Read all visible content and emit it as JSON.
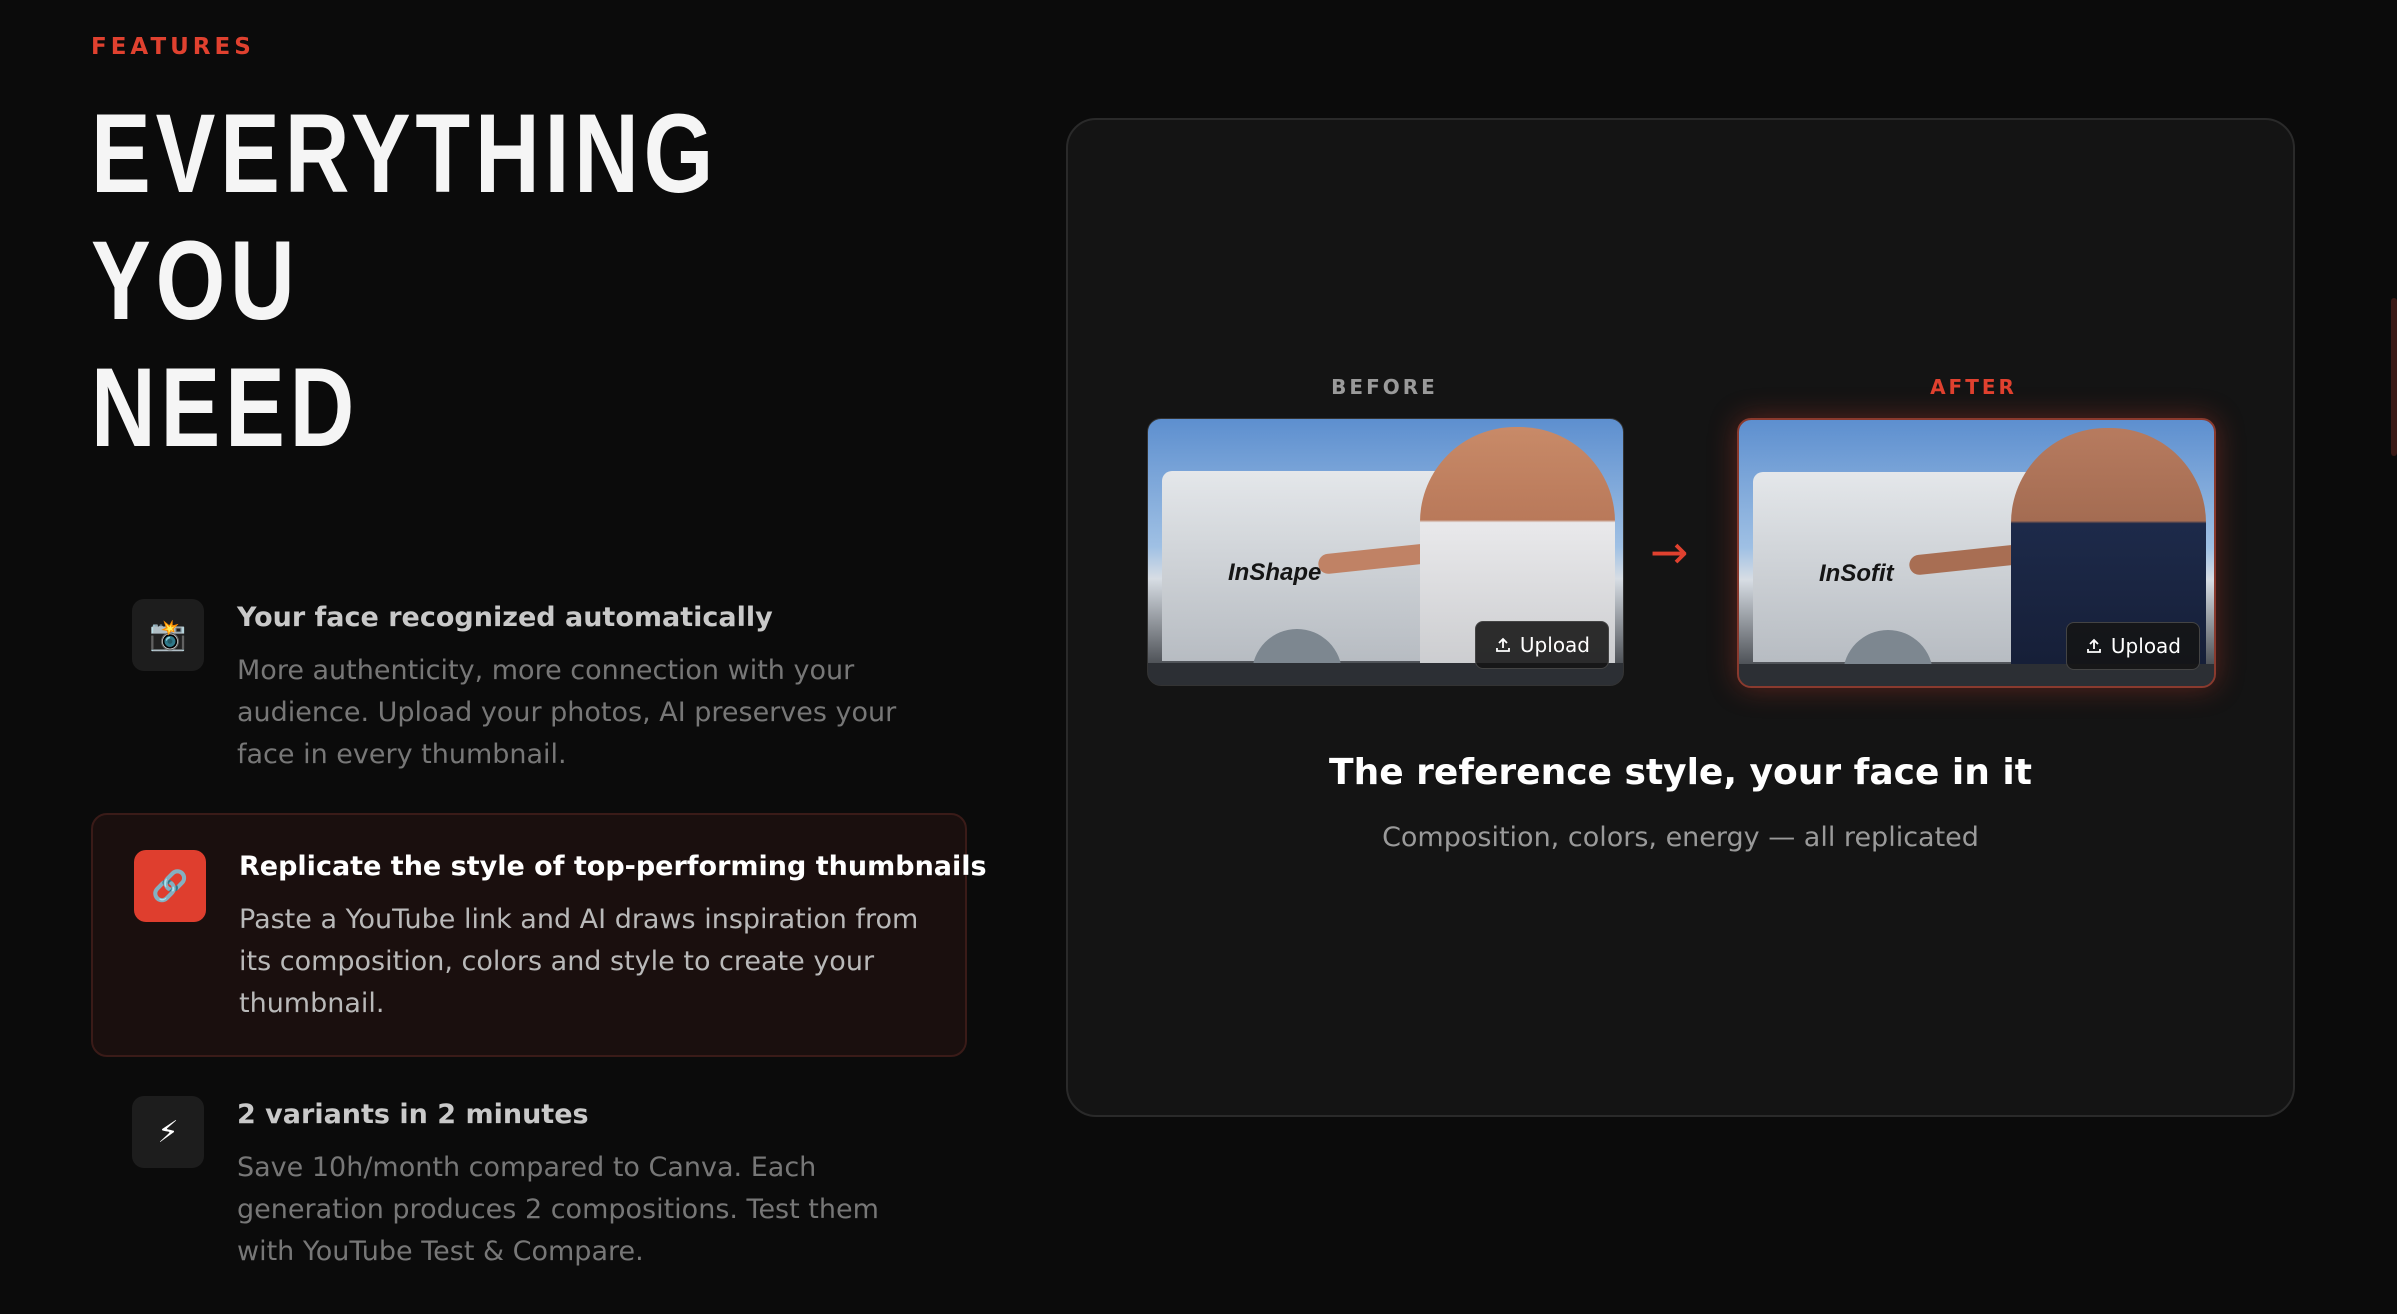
{
  "section": {
    "eyebrow": "FEATURES",
    "headline": [
      "EVERYTHING",
      "YOU",
      "NEED"
    ]
  },
  "features": [
    {
      "icon": "camera-icon",
      "glyph": "📸",
      "title": "Your face recognized automatically",
      "description": "More authenticity, more connection with your audience. Upload your photos, AI preserves your face in every thumbnail.",
      "active": false
    },
    {
      "icon": "link-icon",
      "glyph": "🔗",
      "title": "Replicate the style of top-performing thumbnails",
      "description": "Paste a YouTube link and AI draws inspiration from its composition, colors and style to create your thumbnail.",
      "active": true
    },
    {
      "icon": "lightning-icon",
      "glyph": "⚡",
      "title": "2 variants in 2 minutes",
      "description": "Save 10h/month compared to Canva. Each generation produces 2 compositions. Test them with YouTube Test & Compare.",
      "active": false
    }
  ],
  "preview": {
    "before_label": "BEFORE",
    "after_label": "AFTER",
    "before_logo": "InShape",
    "after_logo": "InSofit",
    "upload_label": "Upload",
    "arrow": "→",
    "title": "The reference style, your face in it",
    "subtitle": "Composition, colors, energy — all replicated"
  },
  "colors": {
    "accent": "#e0412f",
    "background": "#0b0b0b",
    "panel": "#141414"
  }
}
